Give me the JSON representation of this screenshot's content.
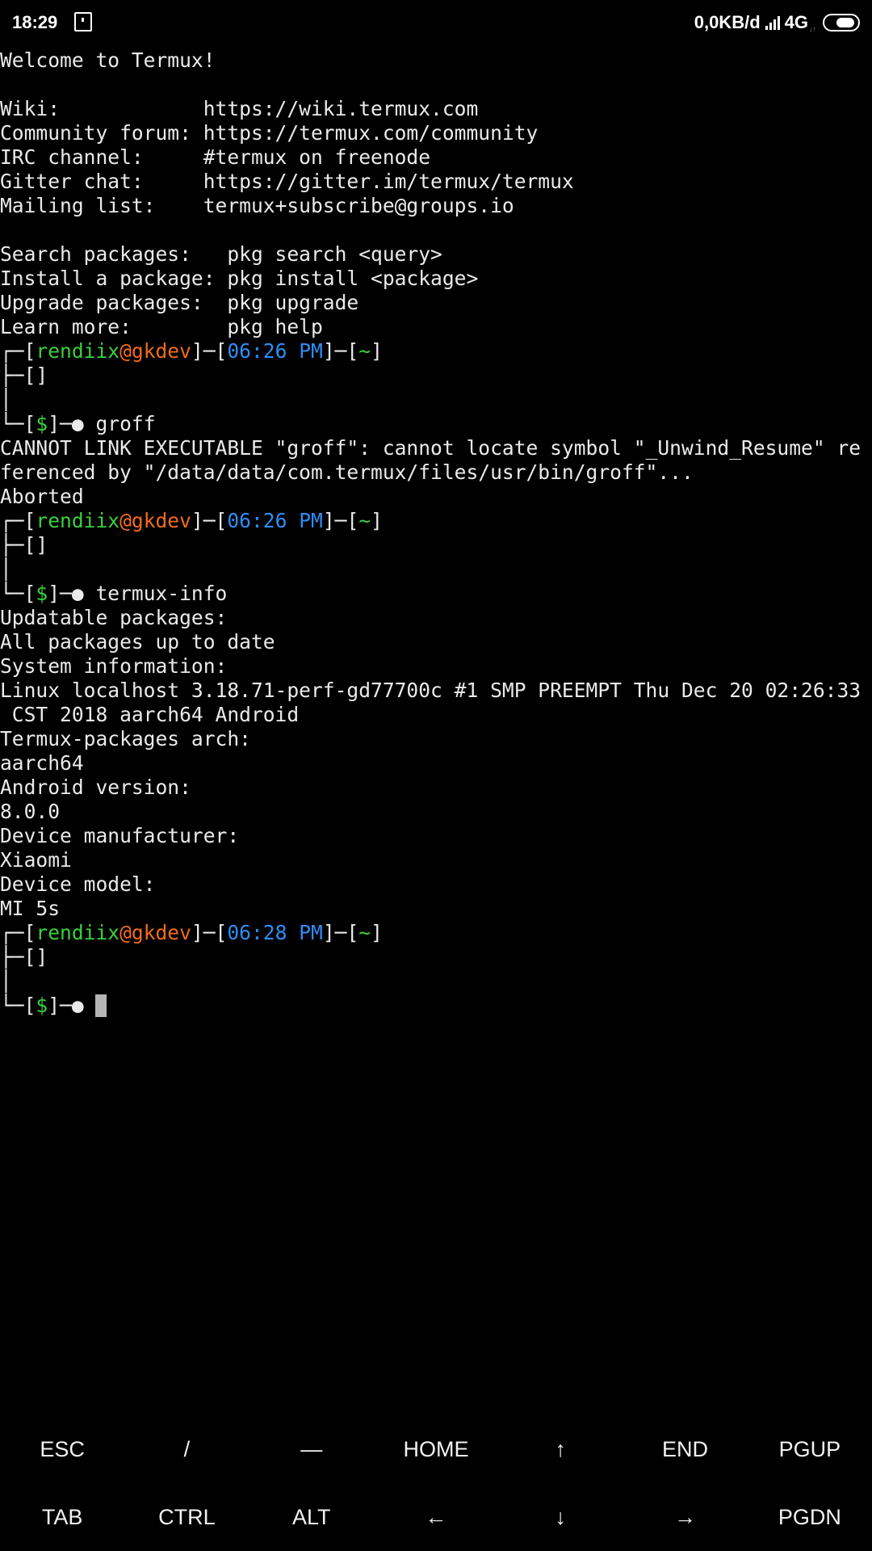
{
  "status_bar": {
    "time": "18:29",
    "net_speed": "0,0KB/d",
    "network_type": "4G",
    "network_sub": "↓↑",
    "icons": [
      "sim-card-icon",
      "signal-icon",
      "battery-icon"
    ]
  },
  "terminal": {
    "lines": [
      [
        {
          "t": "Welcome to Termux!",
          "c": "w"
        }
      ],
      [],
      [
        {
          "t": "Wiki:            https://wiki.termux.com",
          "c": "w"
        }
      ],
      [
        {
          "t": "Community forum: https://termux.com/community",
          "c": "w"
        }
      ],
      [
        {
          "t": "IRC channel:     #termux on freenode",
          "c": "w"
        }
      ],
      [
        {
          "t": "Gitter chat:     https://gitter.im/termux/termux",
          "c": "w"
        }
      ],
      [
        {
          "t": "Mailing list:    termux+subscribe@groups.io",
          "c": "w"
        }
      ],
      [],
      [
        {
          "t": "Search packages:   pkg search <query>",
          "c": "w"
        }
      ],
      [
        {
          "t": "Install a package: pkg install <package>",
          "c": "w"
        }
      ],
      [
        {
          "t": "Upgrade packages:  pkg upgrade",
          "c": "w"
        }
      ],
      [
        {
          "t": "Learn more:        pkg help",
          "c": "w"
        }
      ],
      [
        {
          "t": "┌─[",
          "c": "w"
        },
        {
          "t": "rendiix",
          "c": "g"
        },
        {
          "t": "@",
          "c": "o"
        },
        {
          "t": "gkdev",
          "c": "o"
        },
        {
          "t": "]─[",
          "c": "w"
        },
        {
          "t": "06:26 PM",
          "c": "b"
        },
        {
          "t": "]─[",
          "c": "w"
        },
        {
          "t": "~",
          "c": "g"
        },
        {
          "t": "]",
          "c": "w"
        }
      ],
      [
        {
          "t": "├─[]",
          "c": "w"
        }
      ],
      [
        {
          "t": "│",
          "c": "w"
        }
      ],
      [
        {
          "t": "└─[",
          "c": "w"
        },
        {
          "t": "$",
          "c": "g"
        },
        {
          "t": "]─● groff",
          "c": "w"
        }
      ],
      [
        {
          "t": "CANNOT LINK EXECUTABLE \"groff\": cannot locate symbol \"_Unwind_Resume\" re",
          "c": "w"
        }
      ],
      [
        {
          "t": "ferenced by \"/data/data/com.termux/files/usr/bin/groff\"...",
          "c": "w"
        }
      ],
      [
        {
          "t": "Aborted",
          "c": "w"
        }
      ],
      [
        {
          "t": "┌─[",
          "c": "w"
        },
        {
          "t": "rendiix",
          "c": "g"
        },
        {
          "t": "@",
          "c": "o"
        },
        {
          "t": "gkdev",
          "c": "o"
        },
        {
          "t": "]─[",
          "c": "w"
        },
        {
          "t": "06:26 PM",
          "c": "b"
        },
        {
          "t": "]─[",
          "c": "w"
        },
        {
          "t": "~",
          "c": "g"
        },
        {
          "t": "]",
          "c": "w"
        }
      ],
      [
        {
          "t": "├─[]",
          "c": "w"
        }
      ],
      [
        {
          "t": "│",
          "c": "w"
        }
      ],
      [
        {
          "t": "└─[",
          "c": "w"
        },
        {
          "t": "$",
          "c": "g"
        },
        {
          "t": "]─● termux-info",
          "c": "w"
        }
      ],
      [
        {
          "t": "Updatable packages:",
          "c": "w"
        }
      ],
      [
        {
          "t": "All packages up to date",
          "c": "w"
        }
      ],
      [
        {
          "t": "System information:",
          "c": "w"
        }
      ],
      [
        {
          "t": "Linux localhost 3.18.71-perf-gd77700c #1 SMP PREEMPT Thu Dec 20 02:26:33",
          "c": "w"
        }
      ],
      [
        {
          "t": " CST 2018 aarch64 Android",
          "c": "w"
        }
      ],
      [
        {
          "t": "Termux-packages arch:",
          "c": "w"
        }
      ],
      [
        {
          "t": "aarch64",
          "c": "w"
        }
      ],
      [
        {
          "t": "Android version:",
          "c": "w"
        }
      ],
      [
        {
          "t": "8.0.0",
          "c": "w"
        }
      ],
      [
        {
          "t": "Device manufacturer:",
          "c": "w"
        }
      ],
      [
        {
          "t": "Xiaomi",
          "c": "w"
        }
      ],
      [
        {
          "t": "Device model:",
          "c": "w"
        }
      ],
      [
        {
          "t": "MI 5s",
          "c": "w"
        }
      ],
      [
        {
          "t": "┌─[",
          "c": "w"
        },
        {
          "t": "rendiix",
          "c": "g"
        },
        {
          "t": "@",
          "c": "o"
        },
        {
          "t": "gkdev",
          "c": "o"
        },
        {
          "t": "]─[",
          "c": "w"
        },
        {
          "t": "06:28 PM",
          "c": "b"
        },
        {
          "t": "]─[",
          "c": "w"
        },
        {
          "t": "~",
          "c": "g"
        },
        {
          "t": "]",
          "c": "w"
        }
      ],
      [
        {
          "t": "├─[]",
          "c": "w"
        }
      ],
      [
        {
          "t": "│",
          "c": "w"
        }
      ],
      [
        {
          "t": "└─[",
          "c": "w"
        },
        {
          "t": "$",
          "c": "g"
        },
        {
          "t": "]─● ",
          "c": "w"
        },
        {
          "cursor": true
        }
      ]
    ]
  },
  "extra_keys": {
    "row1": [
      "ESC",
      "/",
      "—",
      "HOME",
      "↑",
      "END",
      "PGUP"
    ],
    "row2": [
      "TAB",
      "CTRL",
      "ALT",
      "←",
      "↓",
      "→",
      "PGDN"
    ]
  },
  "colors": {
    "background": "#000000",
    "text": "#eaeaea",
    "user_green": "#39d13c",
    "host_orange": "#f26b1c",
    "time_blue": "#2d8ef6",
    "cursor": "#b5b5b5"
  }
}
